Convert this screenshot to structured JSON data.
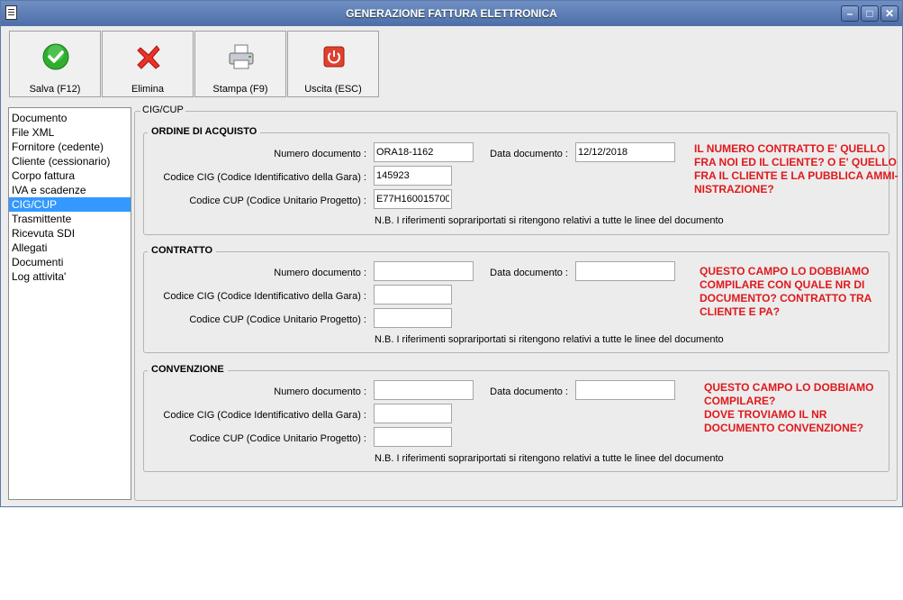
{
  "window": {
    "title": "GENERAZIONE FATTURA ELETTRONICA"
  },
  "window_controls": {
    "minimize": "–",
    "maximize": "□",
    "close": "✕"
  },
  "toolbar": {
    "save_label": "Salva (F12)",
    "delete_label": "Elimina",
    "print_label": "Stampa (F9)",
    "exit_label": "Uscita (ESC)"
  },
  "icons": {
    "save": "checkmark-icon",
    "delete": "red-x-icon",
    "print": "printer-icon",
    "exit": "power-icon"
  },
  "sidebar": {
    "items": [
      {
        "label": "Documento"
      },
      {
        "label": "File XML"
      },
      {
        "label": "Fornitore (cedente)"
      },
      {
        "label": "Cliente (cessionario)"
      },
      {
        "label": "Corpo fattura"
      },
      {
        "label": "IVA e scadenze"
      },
      {
        "label": "CIG/CUP",
        "selected": true
      },
      {
        "label": "Trasmittente"
      },
      {
        "label": "Ricevuta SDI"
      },
      {
        "label": "Allegati"
      },
      {
        "label": "Documenti"
      },
      {
        "label": "Log attivita'"
      }
    ],
    "selected_color": "#3399ff"
  },
  "main": {
    "panel_title": "CIG/CUP"
  },
  "labels": {
    "numero": "Numero documento :",
    "data": "Data documento :",
    "cig": "Codice CIG (Codice Identificativo della Gara) :",
    "cup": "Codice CUP (Codice Unitario Progetto) :",
    "nb": "N.B. I riferimenti soprariportati si ritengono relativi a tutte le linee del documento"
  },
  "sections": {
    "ordine": {
      "title": "ORDINE DI ACQUISTO",
      "numero": "ORA18-1162",
      "data": "12/12/2018",
      "cig": "145923",
      "cup": "E77H160015700(",
      "note": "IL NUMERO CONTRATTO E' QUELLO\nFRA NOI ED IL CLIENTE? O E' QUELLO\nFRA IL CLIENTE E LA PUBBLICA AMMI-\nNISTRAZIONE?"
    },
    "contratto": {
      "title": "CONTRATTO",
      "numero": "",
      "data": "",
      "cig": "",
      "cup": "",
      "note": "QUESTO CAMPO LO DOBBIAMO\nCOMPILARE CON QUALE NR DI\nDOCUMENTO? CONTRATTO TRA\nCLIENTE E PA?"
    },
    "convenzione": {
      "title": "CONVENZIONE",
      "numero": "",
      "data": "",
      "cig": "",
      "cup": "",
      "note": "QUESTO CAMPO LO DOBBIAMO\nCOMPILARE?\nDOVE TROVIAMO IL NR\nDOCUMENTO CONVENZIONE?"
    }
  },
  "colors": {
    "titlebar": "#5a7bb5",
    "note_text": "#e0191c",
    "background": "#ececec"
  }
}
